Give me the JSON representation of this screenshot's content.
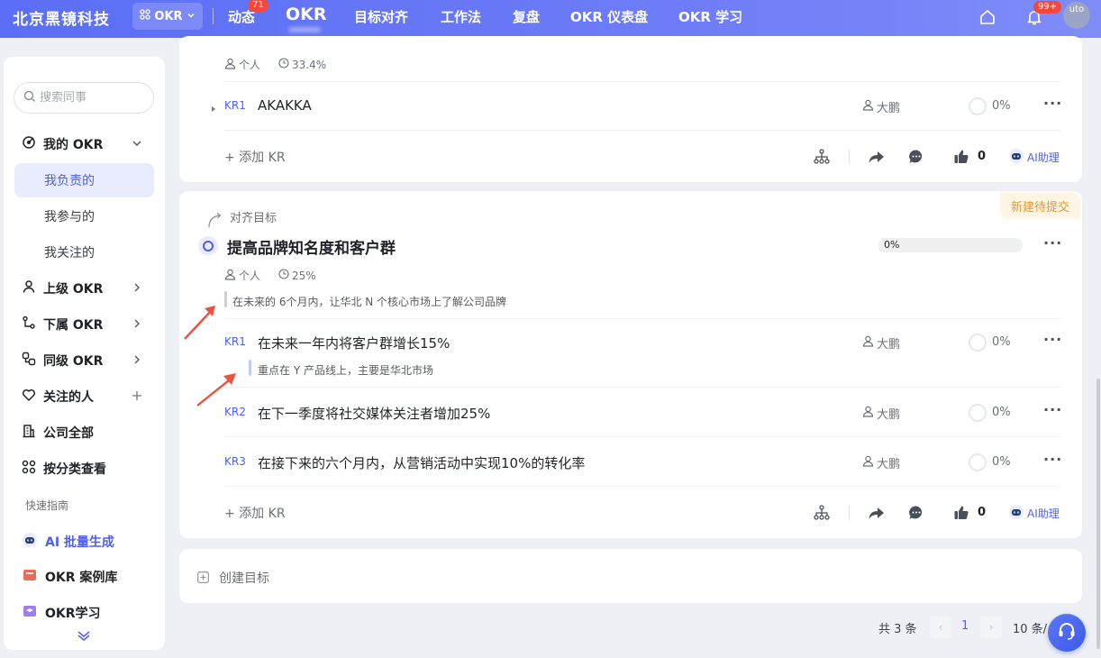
{
  "header": {
    "brand": "北京黑镜科技",
    "switcher": "OKR",
    "nav": [
      {
        "label": "动态",
        "badge": "71"
      },
      {
        "label": "OKR"
      },
      {
        "label": "目标对齐"
      },
      {
        "label": "工作法"
      },
      {
        "label": "复盘"
      },
      {
        "label": "OKR 仪表盘"
      },
      {
        "label": "OKR 学习"
      }
    ],
    "notif_badge": "99+",
    "avatar_text": "uto"
  },
  "sidebar": {
    "search_placeholder": "搜索同事",
    "my_okr": "我的 OKR",
    "sub": [
      "我负责的",
      "我参与的",
      "我关注的"
    ],
    "items": [
      "上级 OKR",
      "下属 OKR",
      "同级 OKR",
      "关注的人",
      "公司全部",
      "按分类查看"
    ],
    "guide_title": "快速指南",
    "guide": [
      "AI 批量生成",
      "OKR 案例库",
      "OKR学习"
    ]
  },
  "card1": {
    "meta_owner": "个人",
    "meta_progress": "33.4%",
    "kr1_tag": "KR1",
    "kr1_title": "AKAKKA",
    "kr1_owner": "大鹏",
    "kr1_pct": "0%",
    "add_kr": "添加 KR",
    "likes": "0",
    "ai": "AI助理"
  },
  "card2": {
    "status": "新建待提交",
    "align": "对齐目标",
    "title": "提高品牌知名度和客户群",
    "progress": "0%",
    "meta_owner": "个人",
    "meta_progress": "25%",
    "desc": "在未来的 6个月内，让华北 N 个核心市场上了解公司品牌",
    "krs": [
      {
        "tag": "KR1",
        "title": "在未来一年内将客户群增长15%",
        "owner": "大鹏",
        "pct": "0%",
        "desc": "重点在 Y 产品线上，主要是华北市场"
      },
      {
        "tag": "KR2",
        "title": "在下一季度将社交媒体关注者增加25%",
        "owner": "大鹏",
        "pct": "0%"
      },
      {
        "tag": "KR3",
        "title": "在接下来的六个月内，从营销活动中实现10%的转化率",
        "owner": "大鹏",
        "pct": "0%"
      }
    ],
    "add_kr": "添加 KR",
    "likes": "0",
    "ai": "AI助理"
  },
  "create": "创建目标",
  "pager": {
    "total": "共 3 条",
    "page": "1",
    "size": "10 条/"
  }
}
